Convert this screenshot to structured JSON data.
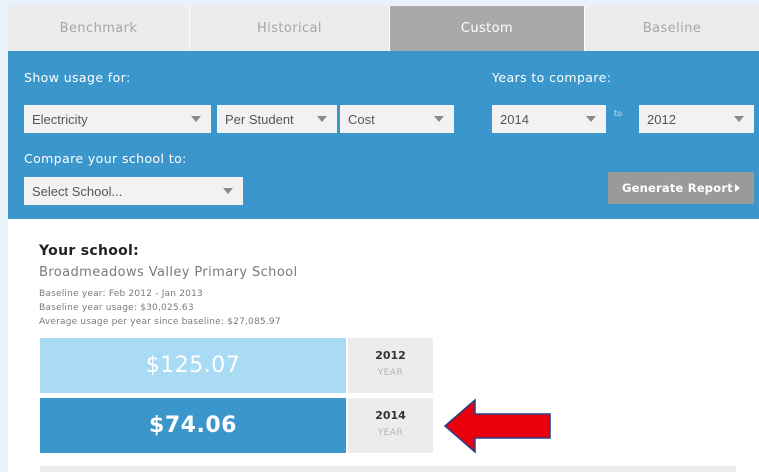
{
  "tabs": [
    {
      "label": "Benchmark"
    },
    {
      "label": "Historical"
    },
    {
      "label": "Custom"
    },
    {
      "label": "Baseline"
    }
  ],
  "panel": {
    "show_usage_label": "Show usage for:",
    "years_label": "Years to compare:",
    "compare_label": "Compare your school to:",
    "to_label": "to",
    "usage_type": "Electricity",
    "normalize": "Per Student",
    "metric": "Cost",
    "year_from": "2014",
    "year_to": "2012",
    "school_select_placeholder": "Select School...",
    "generate_button": "Generate Report"
  },
  "school": {
    "heading": "Your school:",
    "name": "Broadmeadows Valley Primary School",
    "baseline_year": "Baseline year: Feb 2012 - Jan 2013",
    "baseline_usage": "Baseline year usage: $30,025.63",
    "average_usage": "Average usage per year since baseline: $27,085.97"
  },
  "results": [
    {
      "amount": "$125.07",
      "year": "2012",
      "year_caption": "YEAR"
    },
    {
      "amount": "$74.06",
      "year": "2014",
      "year_caption": "YEAR"
    }
  ],
  "colors": {
    "panel_blue": "#3a96cb",
    "light_blue": "#a9dbf5",
    "annotation_arrow": "#e8000d"
  }
}
